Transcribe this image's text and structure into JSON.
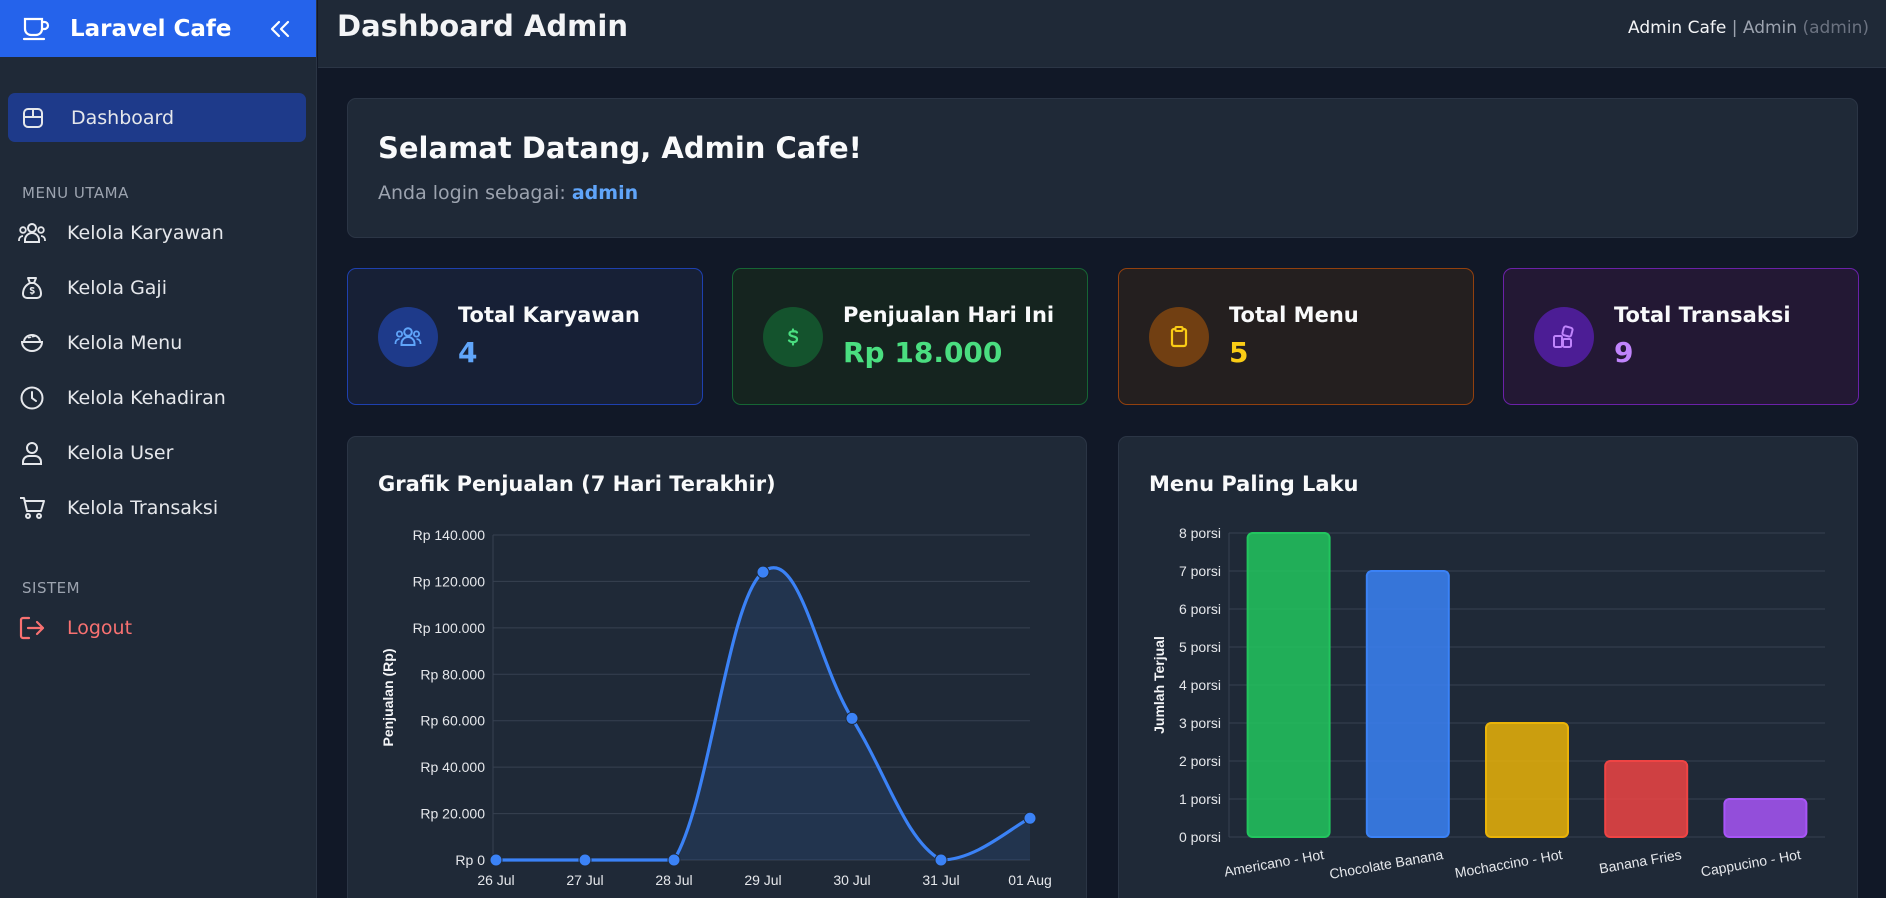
{
  "brand": {
    "name": "Laravel Cafe",
    "icon": "coffee-cup-icon"
  },
  "sidebar": {
    "active": {
      "label": "Dashboard",
      "icon": "dashboard-icon"
    },
    "section_main": "MENU UTAMA",
    "items": [
      {
        "label": "Kelola Karyawan",
        "icon": "users-icon"
      },
      {
        "label": "Kelola Gaji",
        "icon": "money-bag-icon"
      },
      {
        "label": "Kelola Menu",
        "icon": "food-bowl-icon"
      },
      {
        "label": "Kelola Kehadiran",
        "icon": "clock-icon"
      },
      {
        "label": "Kelola User",
        "icon": "user-icon"
      },
      {
        "label": "Kelola Transaksi",
        "icon": "cart-icon"
      }
    ],
    "section_system": "SISTEM",
    "logout": {
      "label": "Logout",
      "icon": "logout-icon"
    }
  },
  "header": {
    "title": "Dashboard Admin",
    "user_name": "Admin Cafe",
    "separator": "|",
    "user_role": "Admin",
    "user_role_code": "(admin)"
  },
  "welcome": {
    "title": "Selamat Datang, Admin Cafe!",
    "subtitle": "Anda login sebagai:",
    "role": "admin"
  },
  "stats": [
    {
      "label": "Total Karyawan",
      "value": "4",
      "icon": "users-icon",
      "color": "#60a5fa"
    },
    {
      "label": "Penjualan Hari Ini",
      "value": "Rp 18.000",
      "icon": "dollar-icon",
      "color": "#4ade80"
    },
    {
      "label": "Total Menu",
      "value": "5",
      "icon": "clipboard-icon",
      "color": "#facc15"
    },
    {
      "label": "Total Transaksi",
      "value": "9",
      "icon": "shapes-icon",
      "color": "#c084fc"
    }
  ],
  "chart_data": [
    {
      "type": "line",
      "title": "Grafik Penjualan (7 Hari Terakhir)",
      "ylabel": "Penjualan (Rp)",
      "xlabel": "",
      "categories": [
        "26 Jul",
        "27 Jul",
        "28 Jul",
        "29 Jul",
        "30 Jul",
        "31 Jul",
        "01 Aug"
      ],
      "values": [
        0,
        0,
        0,
        124000,
        61000,
        0,
        18000
      ],
      "ylim": [
        0,
        140000
      ],
      "yticks": [
        "Rp 0",
        "Rp 20.000",
        "Rp 40.000",
        "Rp 60.000",
        "Rp 80.000",
        "Rp 100.000",
        "Rp 120.000",
        "Rp 140.000"
      ],
      "color": "#3b82f6",
      "fill": true,
      "grid": true
    },
    {
      "type": "bar",
      "title": "Menu Paling Laku",
      "ylabel": "Jumlah Terjual",
      "xlabel": "",
      "categories": [
        "Americano - Hot",
        "Chocolate Banana",
        "Mochaccino - Hot",
        "Banana Fries",
        "Cappucino - Hot"
      ],
      "values": [
        8,
        7,
        3,
        2,
        1
      ],
      "ylim": [
        0,
        8
      ],
      "yticks": [
        "0 porsi",
        "1 porsi",
        "2 porsi",
        "3 porsi",
        "4 porsi",
        "5 porsi",
        "6 porsi",
        "7 porsi",
        "8 porsi"
      ],
      "colors": [
        "#22c55e",
        "#3b82f6",
        "#eab308",
        "#ef4444",
        "#a855f7"
      ],
      "grid": true
    }
  ]
}
